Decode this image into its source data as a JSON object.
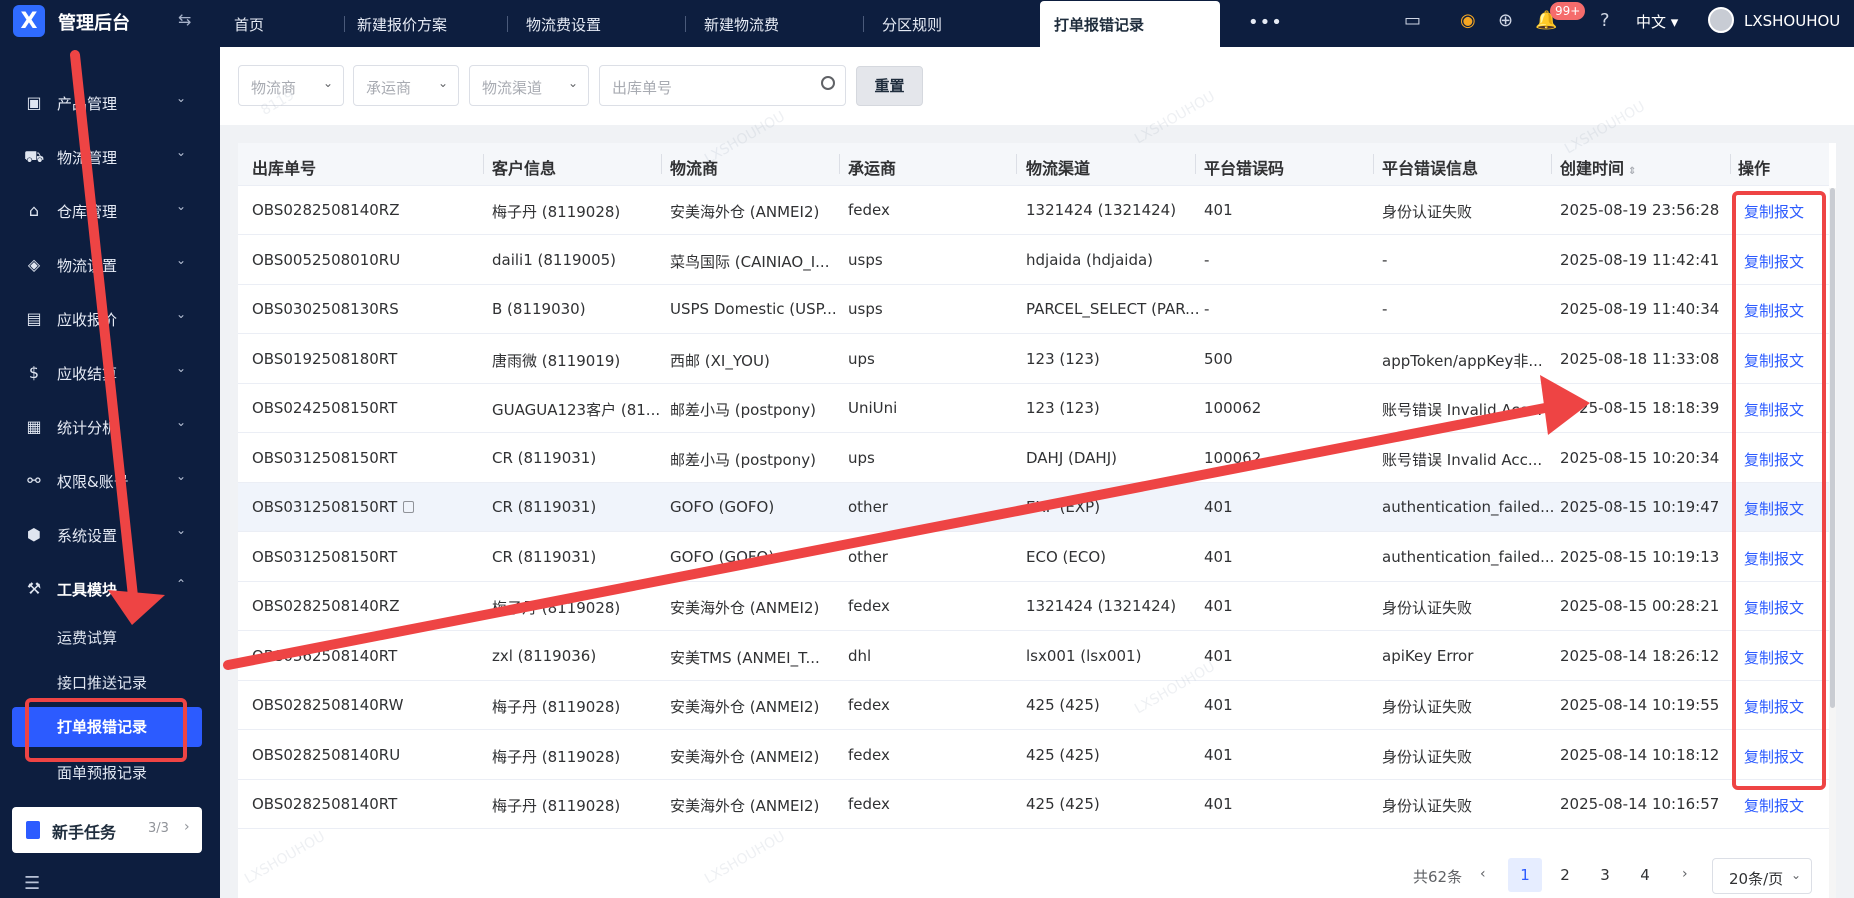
{
  "app": {
    "title": "管理后台",
    "logo_icon": "x-logo-icon"
  },
  "tabs": [
    {
      "label": "首页"
    },
    {
      "label": "新建报价方案"
    },
    {
      "label": "物流费设置"
    },
    {
      "label": "新建物流费"
    },
    {
      "label": "分区规则"
    },
    {
      "label": "打单报错记录",
      "active": true
    }
  ],
  "header": {
    "notification_badge": "99+",
    "language": "中文",
    "username": "LXSHOUHOU"
  },
  "sidebar": {
    "items": [
      {
        "label": "产品管理",
        "icon": "bag-icon"
      },
      {
        "label": "物流管理",
        "icon": "truck-icon"
      },
      {
        "label": "仓库管理",
        "icon": "warehouse-icon"
      },
      {
        "label": "物流设置",
        "icon": "box-settings-icon"
      },
      {
        "label": "应收报价",
        "icon": "document-icon"
      },
      {
        "label": "应收结算",
        "icon": "dollar-icon"
      },
      {
        "label": "统计分析",
        "icon": "chart-icon"
      },
      {
        "label": "权限&账号",
        "icon": "org-icon"
      },
      {
        "label": "系统设置",
        "icon": "hexagon-icon"
      },
      {
        "label": "工具模块",
        "icon": "wrench-icon",
        "expanded": true
      }
    ],
    "subitems": [
      {
        "label": "运费试算"
      },
      {
        "label": "接口推送记录"
      },
      {
        "label": "打单报错记录",
        "active": true
      },
      {
        "label": "面单预报记录"
      }
    ],
    "newbie": {
      "label": "新手任务",
      "count": "3/3"
    }
  },
  "filters": {
    "logistics_provider_placeholder": "物流商",
    "carrier_placeholder": "承运商",
    "channel_placeholder": "物流渠道",
    "order_no_placeholder": "出库单号",
    "reset_label": "重置"
  },
  "table": {
    "columns": [
      "出库单号",
      "客户信息",
      "物流商",
      "承运商",
      "物流渠道",
      "平台错误码",
      "平台错误信息",
      "创建时间",
      "操作"
    ],
    "rows": [
      [
        "OBS0282508140RZ",
        "梅子丹 (8119028)",
        "安美海外仓 (ANMEI2)",
        "fedex",
        "1321424 (1321424)",
        "401",
        "身份认证失败",
        "2025-08-19 23:56:28",
        "复制报文"
      ],
      [
        "OBS0052508010RU",
        "daili1 (8119005)",
        "菜鸟国际 (CAINIAO_I...",
        "usps",
        "hdjaida (hdjaida)",
        "-",
        "-",
        "2025-08-19 11:42:41",
        "复制报文"
      ],
      [
        "OBS0302508130RS",
        "B (8119030)",
        "USPS Domestic (USP...",
        "usps",
        "PARCEL_SELECT (PAR...",
        "-",
        "-",
        "2025-08-19 11:40:34",
        "复制报文"
      ],
      [
        "OBS0192508180RT",
        "唐雨微 (8119019)",
        "西邮 (XI_YOU)",
        "ups",
        "123 (123)",
        "500",
        "appToken/appKey非...",
        "2025-08-18 11:33:08",
        "复制报文"
      ],
      [
        "OBS0242508150RT",
        "GUAGUA123客户 (81...",
        "邮差小马 (postpony)",
        "UniUni",
        "123 (123)",
        "100062",
        "账号错误 Invalid Acc...",
        "2025-08-15 18:18:39",
        "复制报文"
      ],
      [
        "OBS0312508150RT",
        "CR (8119031)",
        "邮差小马 (postpony)",
        "ups",
        "DAHJ (DAHJ)",
        "100062",
        "账号错误 Invalid Acc...",
        "2025-08-15 10:20:34",
        "复制报文"
      ],
      [
        "OBS0312508150RT",
        "CR (8119031)",
        "GOFO (GOFO)",
        "other",
        "EXP (EXP)",
        "401",
        "authentication_failed...",
        "2025-08-15 10:19:47",
        "复制报文"
      ],
      [
        "OBS0312508150RT",
        "CR (8119031)",
        "GOFO (GOFO)",
        "other",
        "ECO (ECO)",
        "401",
        "authentication_failed...",
        "2025-08-15 10:19:13",
        "复制报文"
      ],
      [
        "OBS0282508140RZ",
        "梅子丹 (8119028)",
        "安美海外仓 (ANMEI2)",
        "fedex",
        "1321424 (1321424)",
        "401",
        "身份认证失败",
        "2025-08-15 00:28:21",
        "复制报文"
      ],
      [
        "OBS0362508140RT",
        "zxl (8119036)",
        "安美TMS (ANMEI_T...",
        "dhl",
        "lsx001 (lsx001)",
        "401",
        "apiKey Error",
        "2025-08-14 18:26:12",
        "复制报文"
      ],
      [
        "OBS0282508140RW",
        "梅子丹 (8119028)",
        "安美海外仓 (ANMEI2)",
        "fedex",
        "425 (425)",
        "401",
        "身份认证失败",
        "2025-08-14 10:19:55",
        "复制报文"
      ],
      [
        "OBS0282508140RU",
        "梅子丹 (8119028)",
        "安美海外仓 (ANMEI2)",
        "fedex",
        "425 (425)",
        "401",
        "身份认证失败",
        "2025-08-14 10:18:12",
        "复制报文"
      ],
      [
        "OBS0282508140RT",
        "梅子丹 (8119028)",
        "安美海外仓 (ANMEI2)",
        "fedex",
        "425 (425)",
        "401",
        "身份认证失败",
        "2025-08-14 10:16:57",
        "复制报文"
      ]
    ]
  },
  "pagination": {
    "total": "共62条",
    "pages": [
      "1",
      "2",
      "3",
      "4"
    ],
    "current": "1",
    "page_size": "20条/页"
  },
  "watermark": {
    "line1": "8119",
    "line2": "LXSHOUHOU"
  },
  "colors": {
    "accent": "#2c5bff",
    "sidebar_bg": "#0d1e3f",
    "annotation": "#ee4444"
  }
}
